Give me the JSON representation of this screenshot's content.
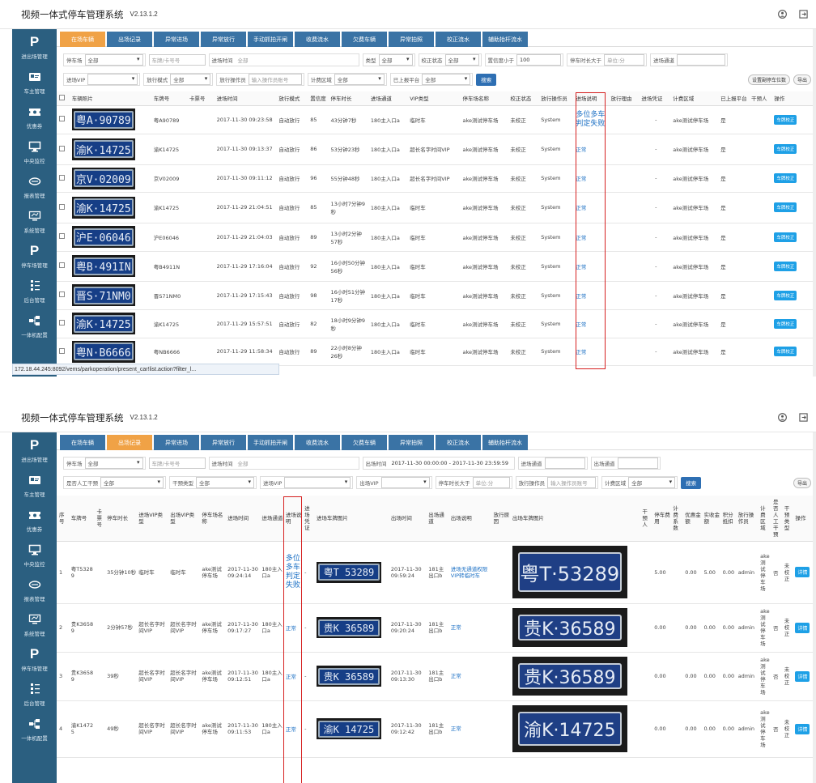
{
  "app": {
    "title": "视频一体式停车管理系统",
    "version": "V2.13.1.2"
  },
  "sidebar": [
    {
      "icon": "P",
      "label": "进出场管理"
    },
    {
      "icon": "car-card-icon",
      "label": "车主管理"
    },
    {
      "icon": "ticket-icon",
      "label": "优惠券"
    },
    {
      "icon": "monitor-icon",
      "label": "中央监控"
    },
    {
      "icon": "coin-icon",
      "label": "报表管理"
    },
    {
      "icon": "display-icon",
      "label": "系统管理"
    },
    {
      "icon": "P",
      "label": "停车场管理"
    },
    {
      "icon": "list-icon",
      "label": "后台管理"
    },
    {
      "icon": "network-icon",
      "label": "一体机配置"
    }
  ],
  "tabs": [
    "在场车辆",
    "出场记录",
    "异常进场",
    "异常放行",
    "手动抓拍开闸",
    "收费流水",
    "欠费车辆",
    "异常拍照",
    "校正流水",
    "辅助抬杆流水"
  ],
  "panel1": {
    "filters_row1": {
      "parking_lot": "停车场",
      "parking_val": "全部",
      "plate": "车牌/卡号号",
      "entry_time": "进场时间",
      "entry_val": "全部",
      "type": "类型",
      "type_val": "全部",
      "correct": "校正状态",
      "correct_val": "全部",
      "conf": "置信度小于",
      "conf_val": "100",
      "duration": "停车时长大于",
      "duration_ph": "单位:分",
      "gate": "进场通道"
    },
    "filters_row2": {
      "vip": "进场VIP",
      "release": "放行模式",
      "release_val": "全部",
      "operator": "放行操作员",
      "operator_ph": "输入操作员账号",
      "billing": "计费区域",
      "billing_val": "全部",
      "uploaded": "已上报平台",
      "uploaded_val": "全部",
      "search": "搜索",
      "btn_a": "设置副停车位数",
      "btn_b": "导出"
    },
    "headers": [
      "车辆照片",
      "车牌号",
      "卡票号",
      "进场时间",
      "放行模式",
      "置信度",
      "停车时长",
      "进场通道",
      "VIP类型",
      "停车场名称",
      "校正状态",
      "放行操作员",
      "进场说明",
      "放行理由",
      "进场凭证",
      "计费区域",
      "已上报平台",
      "干预人",
      "操作"
    ],
    "rows": [
      {
        "plate_img": "粤A·90789",
        "plate": "粤A90789",
        "time": "2017-11-30 09:23:58",
        "mode": "自动放行",
        "conf": "85",
        "dur": "43分钟7秒",
        "gate": "180主入口a",
        "vip": "临时车",
        "lot": "ake测试停车场",
        "corr": "未校正",
        "op": "System",
        "note": "多位多车判定失败",
        "voucher": "-",
        "area": "ake测试停车场",
        "up": "是",
        "action": "车牌校正"
      },
      {
        "plate_img": "渝K·14725",
        "plate": "渝K14725",
        "time": "2017-11-30 09:13:37",
        "mode": "自动放行",
        "conf": "86",
        "dur": "53分钟23秒",
        "gate": "180主入口a",
        "vip": "超长名字时间VIP",
        "lot": "ake测试停车场",
        "corr": "未校正",
        "op": "System",
        "note": "正常",
        "voucher": "-",
        "area": "ake测试停车场",
        "up": "是",
        "action": "车牌校正"
      },
      {
        "plate_img": "京V·02009",
        "plate": "京V02009",
        "time": "2017-11-30 09:11:12",
        "mode": "自动放行",
        "conf": "96",
        "dur": "55分钟48秒",
        "gate": "180主入口a",
        "vip": "超长名字时间VIP",
        "lot": "ake测试停车场",
        "corr": "未校正",
        "op": "System",
        "note": "正常",
        "voucher": "-",
        "area": "ake测试停车场",
        "up": "是",
        "action": "车牌校正"
      },
      {
        "plate_img": "渝K·14725",
        "plate": "渝K14725",
        "time": "2017-11-29 21:04:51",
        "mode": "自动放行",
        "conf": "85",
        "dur": "13小时7分钟9秒",
        "gate": "180主入口a",
        "vip": "临时车",
        "lot": "ake测试停车场",
        "corr": "未校正",
        "op": "System",
        "note": "正常",
        "voucher": "-",
        "area": "ake测试停车场",
        "up": "是",
        "action": "车牌校正"
      },
      {
        "plate_img": "沪E·06046",
        "plate": "沪E06046",
        "time": "2017-11-29 21:04:03",
        "mode": "自动放行",
        "conf": "89",
        "dur": "13小时2分钟57秒",
        "gate": "180主入口a",
        "vip": "临时车",
        "lot": "ake测试停车场",
        "corr": "未校正",
        "op": "System",
        "note": "正常",
        "voucher": "-",
        "area": "ake测试停车场",
        "up": "是",
        "action": "车牌校正"
      },
      {
        "plate_img": "粤B·491IN",
        "plate": "粤B4911N",
        "time": "2017-11-29 17:16:04",
        "mode": "自动放行",
        "conf": "92",
        "dur": "16小时50分钟56秒",
        "gate": "180主入口a",
        "vip": "临时车",
        "lot": "ake测试停车场",
        "corr": "未校正",
        "op": "System",
        "note": "正常",
        "voucher": "-",
        "area": "ake测试停车场",
        "up": "是",
        "action": "车牌校正"
      },
      {
        "plate_img": "晋S·71NM0",
        "plate": "晋S71NM0",
        "time": "2017-11-29 17:15:43",
        "mode": "自动放行",
        "conf": "98",
        "dur": "16小时51分钟17秒",
        "gate": "180主入口a",
        "vip": "临时车",
        "lot": "ake测试停车场",
        "corr": "未校正",
        "op": "System",
        "note": "正常",
        "voucher": "-",
        "area": "ake测试停车场",
        "up": "是",
        "action": "车牌校正"
      },
      {
        "plate_img": "渝K·14725",
        "plate": "渝K14725",
        "time": "2017-11-29 15:57:51",
        "mode": "自动放行",
        "conf": "82",
        "dur": "18小时9分钟9秒",
        "gate": "180主入口a",
        "vip": "临时车",
        "lot": "ake测试停车场",
        "corr": "未校正",
        "op": "System",
        "note": "正常",
        "voucher": "-",
        "area": "ake测试停车场",
        "up": "是",
        "action": "车牌校正"
      },
      {
        "plate_img": "粤N·B6666",
        "plate": "粤NB6666",
        "time": "2017-11-29 11:58:34",
        "mode": "自动放行",
        "conf": "89",
        "dur": "22小时8分钟26秒",
        "gate": "180主入口a",
        "vip": "临时车",
        "lot": "ake测试停车场",
        "corr": "未校正",
        "op": "System",
        "note": "正常",
        "voucher": "-",
        "area": "ake测试停车场",
        "up": "是",
        "action": "车牌校正"
      }
    ],
    "status_url": "172.18.44.245:8092/vems/parkoperation/present_car!list.action?filter_l..."
  },
  "panel2": {
    "filters_row1": {
      "parking_lot": "停车场",
      "parking_val": "全部",
      "plate": "车牌/卡号号",
      "entry_time": "进场时间",
      "entry_val": "全部",
      "exit_time": "出场时间",
      "exit_val": "2017-11-30 00:00:00 - 2017-11-30 23:59:59",
      "gate_in": "进场通道",
      "gate_out": "出场通道"
    },
    "filters_row2": {
      "manual": "是否人工干预",
      "manual_val": "全部",
      "type": "干预类型",
      "type_val": "全部",
      "vip_in": "进场VIP",
      "vip_out": "出场VIP",
      "duration": "停车时长大于",
      "duration_ph": "单位:分",
      "operator": "放行操作员",
      "operator_ph": "输入操作员账号",
      "billing": "计费区域",
      "billing_val": "全部",
      "search": "搜索",
      "export": "导出"
    },
    "headers": [
      "序号",
      "车牌号",
      "卡票号",
      "停车时长",
      "进场VIP类型",
      "出场VIP类型",
      "停车场名称",
      "进场时间",
      "进场通道",
      "进场说明",
      "进场凭证",
      "进场车牌图片",
      "出场时间",
      "出场通道",
      "出场说明",
      "放行原因",
      "出场车牌图片",
      "干预人",
      "停车费用",
      "计费系数",
      "优惠金额",
      "实收金额",
      "积分抵扣",
      "放行操作员",
      "计费区域",
      "是否人工干预",
      "干预类型",
      "操作"
    ],
    "rows": [
      {
        "no": "1",
        "plate": "粤T53289",
        "dur": "35分钟10秒",
        "vip_in": "临时车",
        "vip_out": "临时车",
        "lot": "ake测试停车场",
        "in_time": "2017-11-30 09:24:14",
        "in_gate": "180主入口a",
        "in_note": "多位多车判定失败",
        "voucher": "-",
        "in_img": "粤T 53289",
        "out_time": "2017-11-30 09:59:24",
        "out_gate": "181主出口b",
        "out_note": "进场无通道权限VIP转临时车",
        "out_img": "粤T·53289",
        "fee": "5.00",
        "disc": "0.00",
        "paid": "5.00",
        "pts": "0.00",
        "op": "admin",
        "area": "ake测试停车场",
        "manual": "否",
        "itype": "未校正",
        "action": "详情"
      },
      {
        "no": "2",
        "plate": "贵K36589",
        "dur": "2分钟57秒",
        "vip_in": "超长名字时间VIP",
        "vip_out": "超长名字时间VIP",
        "lot": "ake测试停车场",
        "in_time": "2017-11-30 09:17:27",
        "in_gate": "180主入口a",
        "in_note": "正常",
        "voucher": "-",
        "in_img": "贵K 36589",
        "out_time": "2017-11-30 09:20:24",
        "out_gate": "181主出口b",
        "out_note": "正常",
        "out_img": "贵K·36589",
        "fee": "0.00",
        "disc": "0.00",
        "paid": "0.00",
        "pts": "0.00",
        "op": "admin",
        "area": "ake测试停车场",
        "manual": "否",
        "itype": "未校正",
        "action": "详情"
      },
      {
        "no": "3",
        "plate": "贵K36589",
        "dur": "39秒",
        "vip_in": "超长名字时间VIP",
        "vip_out": "超长名字时间VIP",
        "lot": "ake测试停车场",
        "in_time": "2017-11-30 09:12:51",
        "in_gate": "180主入口a",
        "in_note": "正常",
        "voucher": "-",
        "in_img": "贵K 36589",
        "out_time": "2017-11-30 09:13:30",
        "out_gate": "181主出口b",
        "out_note": "正常",
        "out_img": "贵K·36589",
        "fee": "0.00",
        "disc": "0.00",
        "paid": "0.00",
        "pts": "0.00",
        "op": "admin",
        "area": "ake测试停车场",
        "manual": "否",
        "itype": "未校正",
        "action": "详情"
      },
      {
        "no": "4",
        "plate": "渝K14725",
        "dur": "49秒",
        "vip_in": "超长名字时间VIP",
        "vip_out": "超长名字时间VIP",
        "lot": "ake测试停车场",
        "in_time": "2017-11-30 09:11:53",
        "in_gate": "180主入口a",
        "in_note": "正常",
        "voucher": "-",
        "in_img": "渝K 14725",
        "out_time": "2017-11-30 09:12:42",
        "out_gate": "181主出口b",
        "out_note": "正常",
        "out_img": "渝K·14725",
        "fee": "0.00",
        "disc": "0.00",
        "paid": "0.00",
        "pts": "0.00",
        "op": "admin",
        "area": "ake测试停车场",
        "manual": "否",
        "itype": "未校正",
        "action": "详情"
      }
    ]
  },
  "colors": {
    "sidebar": "#2b5f80",
    "tab": "#3a73a5",
    "tab_active": "#f0a246",
    "link": "#1a6fc4",
    "button": "#1ea0e6",
    "highlight": "#d62020"
  }
}
